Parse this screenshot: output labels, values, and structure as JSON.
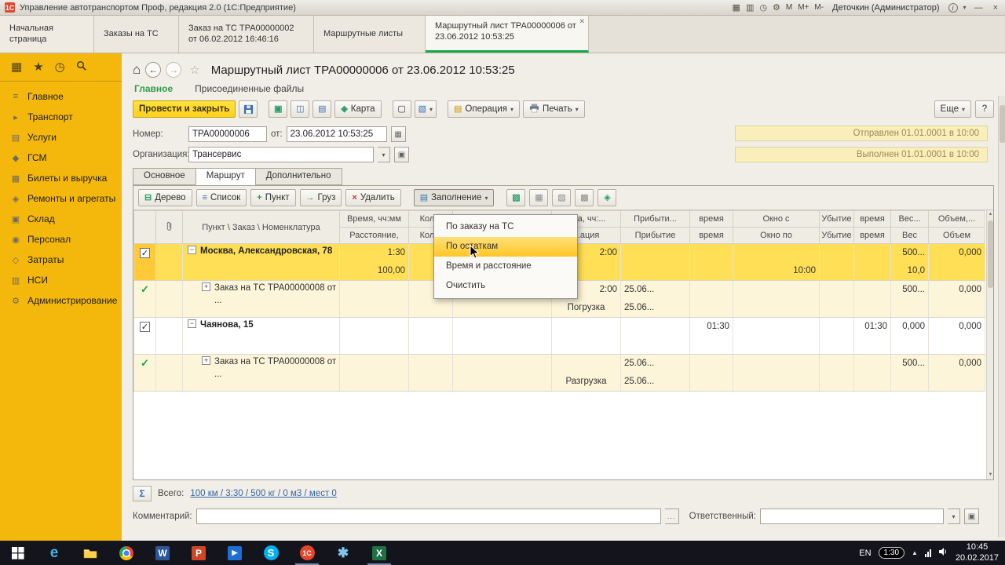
{
  "colors": {
    "sidebar_yellow": "#f4b70c",
    "accent_green": "#18a84a",
    "primary_button_yellow": "#ffd11c",
    "status_bar_bg": "#faeeba",
    "selected_row_yellow": "#ffdf55",
    "order_row_yellow": "#fcf5d9",
    "menu_highlight_yellow": "#ffc627",
    "totals_link_blue": "#3466a5",
    "taskbar_dark": "#13141c"
  },
  "titlebar": {
    "title": "Управление автотранспортом Проф, редакция 2.0  (1С:Предприятие)",
    "icons": [
      "▦",
      "▥",
      "◷",
      "⚙"
    ],
    "mem": [
      "М",
      "М+",
      "М-"
    ],
    "user": "Деточкин (Администратор)",
    "info": "i",
    "minimize": "—",
    "close": "×"
  },
  "tabs": [
    "Начальная страница",
    "Заказы на ТС",
    "Заказ на ТС ТРА00000002 от 06.02.2012 16:46:16",
    "Маршрутные листы",
    "Маршрутный лист ТРА00000006 от 23.06.2012 10:53:25"
  ],
  "sidebar": {
    "items": [
      {
        "label": "Главное",
        "icon": "≡"
      },
      {
        "label": "Транспорт",
        "icon": "▸"
      },
      {
        "label": "Услуги",
        "icon": "▤"
      },
      {
        "label": "ГСМ",
        "icon": "◆"
      },
      {
        "label": "Билеты и выручка",
        "icon": "▦"
      },
      {
        "label": "Ремонты и агрегаты",
        "icon": "◈"
      },
      {
        "label": "Склад",
        "icon": "▣"
      },
      {
        "label": "Персонал",
        "icon": "◉"
      },
      {
        "label": "Затраты",
        "icon": "◇"
      },
      {
        "label": "НСИ",
        "icon": "▥"
      },
      {
        "label": "Администрирование",
        "icon": "⚙"
      }
    ]
  },
  "doc": {
    "title": "Маршрутный лист ТРА00000006 от 23.06.2012 10:53:25",
    "links": [
      "Главное",
      "Присоединенные файлы"
    ],
    "toolbar": {
      "post_close": "Провести и закрыть",
      "map": "Карта",
      "operation": "Операция",
      "print": "Печать",
      "more": "Еще",
      "help": "?"
    },
    "fields": {
      "number_label": "Номер:",
      "number_value": "ТРА00000006",
      "date_label": "от:",
      "date_value": "23.06.2012 10:53:25",
      "org_label": "Организация:",
      "org_value": "Трансервис"
    },
    "statuses": [
      "Отправлен 01.01.0001 в 10:00",
      "Выполнен 01.01.0001 в 10:00"
    ],
    "page_tabs": [
      "Основное",
      "Маршрут",
      "Дополнительно"
    ],
    "route_toolbar": [
      "Дерево",
      "Список",
      "Пункт",
      "Груз",
      "Удалить",
      "Заполнение"
    ],
    "fill_menu": [
      "По заказу на ТС",
      "По остаткам",
      "Время и расстояние",
      "Очистить"
    ],
    "totals_label": "Всего:",
    "totals_value": "100 км / 3:30 / 500 кг / 0 м3 / мест 0",
    "comment_label": "Комментарий:",
    "responsible_label": "Ответственный:"
  },
  "table": {
    "headers": {
      "name": "Пункт \\ Заказ \\ Номенклатура",
      "time_top": "Время, чч:мм",
      "time_bot": "Расстояние,",
      "qty_top": "Кол...",
      "qty_bot": "Кол...",
      "op_top": "...ка, чч:...",
      "op_bot": "...ация",
      "arr_top": "Прибыти...",
      "arr_bot": "Прибытие",
      "t1_top": "время",
      "t1_bot": "время",
      "win_top": "Окно с",
      "win_bot": "Окно по",
      "dep_top": "Убытие",
      "dep_bot": "Убытие",
      "t2_top": "время",
      "t2_bot": "время",
      "w_top": "Вес...",
      "w_bot": "Вес",
      "v_top": "Объем,...",
      "v_bot": "Объем"
    },
    "rows": [
      {
        "toggle": "−",
        "name": "Москва, Александровская, 78",
        "l1": {
          "time": "1:30",
          "op": "2:00",
          "weight": "500...",
          "vol": "0,000"
        },
        "l2": {
          "dist": "100,00",
          "win": "10:00",
          "weight": "10,0"
        }
      },
      {
        "toggle": "+",
        "name": "Заказ на ТС ТРА00000008 от ...",
        "l1": {
          "op": "2:00",
          "arrive": "25.06...",
          "weight": "500...",
          "vol": "0,000"
        },
        "l2": {
          "op": "Погрузка",
          "arrive": "25.06..."
        }
      },
      {
        "toggle": "−",
        "name": "Чаянова, 15",
        "l1": {
          "t1": "01:30",
          "t2": "01:30",
          "weight": "0,000",
          "vol": "0,000"
        },
        "l2": {}
      },
      {
        "toggle": "+",
        "name": "Заказ на ТС ТРА00000008 от ...",
        "l1": {
          "arrive": "25.06...",
          "weight": "500...",
          "vol": "0,000"
        },
        "l2": {
          "op": "Разгрузка",
          "arrive": "25.06..."
        }
      }
    ]
  },
  "glyphs": {
    "grid": "▦",
    "star_fav": "★",
    "history": "◷",
    "home": "⌂",
    "back": "←",
    "fwd": "→",
    "star_off": "☆",
    "caret": "▾",
    "calendar": "▦",
    "post": "▣",
    "dtkt": "◫",
    "journal": "▤",
    "file": "▢",
    "mail": "▧",
    "map": "◈",
    "tree": "⊟",
    "list": "≡",
    "plus": "+",
    "arrow": "→",
    "del": "×",
    "fill": "▤",
    "ico_fill2": "▨",
    "ico_copy": "▦",
    "ico_paste": "▧",
    "ico_clip": "▩",
    "ico_select": "◈",
    "sigma": "Σ",
    "dots": "...",
    "open": "▣",
    "check": "✓"
  },
  "taskbar": {
    "apps": {
      "edge": "e",
      "word": "W",
      "ppoint": "P",
      "media": "▶",
      "skype": "S",
      "onec": "1С",
      "util": "✱",
      "excel": "X"
    },
    "tray": {
      "lang": "EN",
      "battery": "1:30",
      "chevron": "▲",
      "time": "10:45",
      "date": "20.02.2017"
    }
  }
}
